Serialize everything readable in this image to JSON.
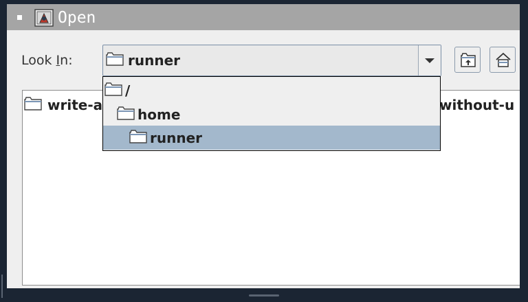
{
  "window": {
    "title": "Open",
    "icons": {
      "menu": "window-menu-icon",
      "app": "java-app-icon"
    }
  },
  "look_in": {
    "label_pre": "Look ",
    "label_mnemonic": "I",
    "label_post": "n:",
    "selected": "runner",
    "icon": "folder-icon"
  },
  "toolbar": {
    "buttons": [
      {
        "name": "up-one-level-button",
        "icon": "folder-up-icon"
      },
      {
        "name": "home-button",
        "icon": "home-icon"
      }
    ]
  },
  "dropdown": {
    "items": [
      {
        "label": "/",
        "indent": 0,
        "selected": false
      },
      {
        "label": "home",
        "indent": 1,
        "selected": false
      },
      {
        "label": "runner",
        "indent": 2,
        "selected": true
      }
    ]
  },
  "file_list": {
    "items": [
      {
        "label_visible_start": "write-a",
        "label_visible_end": "without-u",
        "icon": "folder-icon"
      }
    ]
  },
  "colors": {
    "titlebar": "#a5a5a5",
    "dialog_bg": "#efefef",
    "selection": "#a3b8cc",
    "desktop": "#1b2533"
  }
}
